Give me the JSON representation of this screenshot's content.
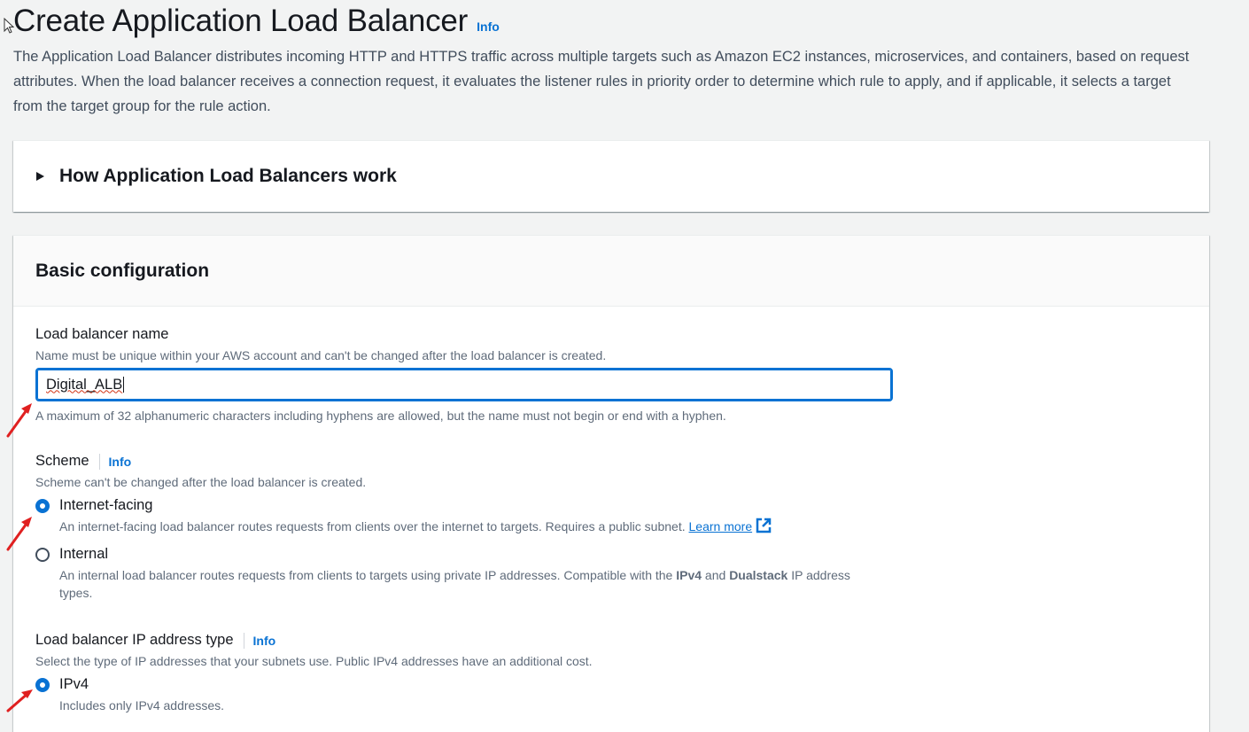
{
  "header": {
    "title": "Create Application Load Balancer",
    "info": "Info",
    "description": "The Application Load Balancer distributes incoming HTTP and HTTPS traffic across multiple targets such as Amazon EC2 instances, microservices, and containers, based on request attributes. When the load balancer receives a connection request, it evaluates the listener rules in priority order to determine which rule to apply, and if applicable, it selects a target from the target group for the rule action."
  },
  "expander": {
    "title": "How Application Load Balancers work"
  },
  "basic": {
    "title": "Basic configuration",
    "name_field": {
      "label": "Load balancer name",
      "hint": "Name must be unique within your AWS account and can't be changed after the load balancer is created.",
      "value": "Digital_ALB",
      "constraint": "A maximum of 32 alphanumeric characters including hyphens are allowed, but the name must not begin or end with a hyphen."
    },
    "scheme": {
      "label": "Scheme",
      "info": "Info",
      "hint": "Scheme can't be changed after the load balancer is created.",
      "options": [
        {
          "label": "Internet-facing",
          "selected": true,
          "desc": "An internet-facing load balancer routes requests from clients over the internet to targets. Requires a public subnet.",
          "link": "Learn more"
        },
        {
          "label": "Internal",
          "selected": false,
          "desc_a": "An internal load balancer routes requests from clients to targets using private IP addresses. Compatible with the ",
          "desc_b": "IPv4",
          "desc_c": " and ",
          "desc_d": "Dualstack",
          "desc_e": " IP address types."
        }
      ]
    },
    "ip_type": {
      "label": "Load balancer IP address type",
      "info": "Info",
      "hint": "Select the type of IP addresses that your subnets use. Public IPv4 addresses have an additional cost.",
      "options": [
        {
          "label": "IPv4",
          "selected": true,
          "desc": "Includes only IPv4 addresses."
        }
      ]
    }
  },
  "colors": {
    "accent": "#0972d3",
    "annotation_arrow": "#e02020"
  }
}
